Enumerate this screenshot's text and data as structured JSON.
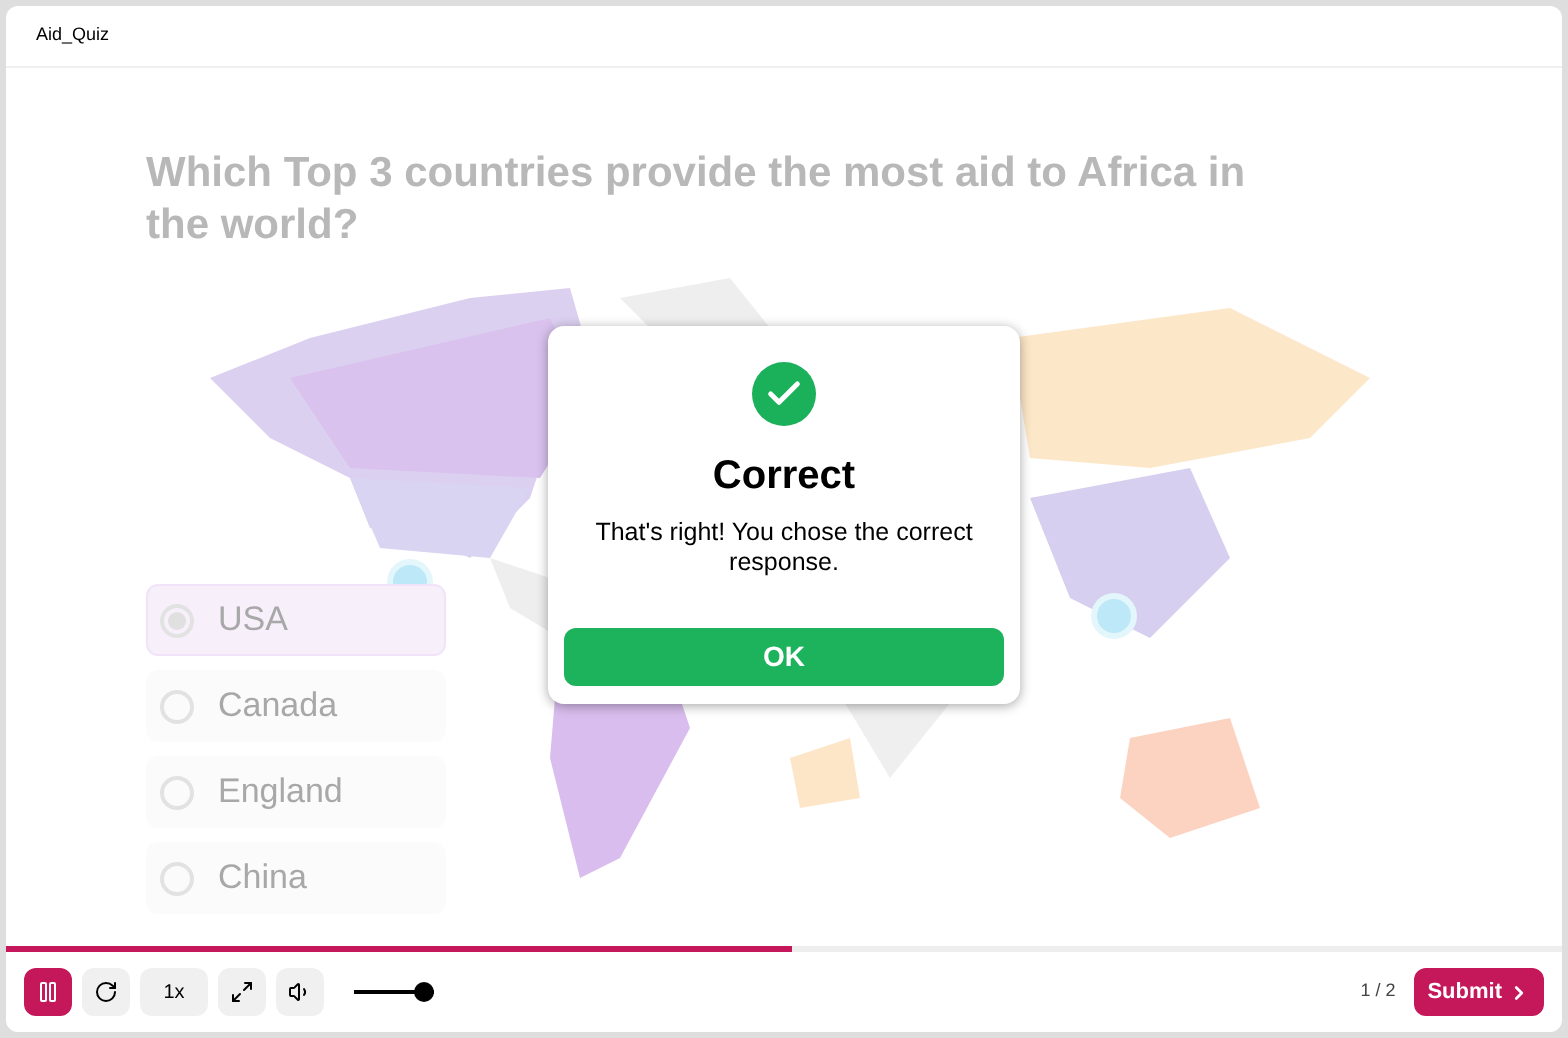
{
  "window": {
    "title": "Aid_Quiz"
  },
  "question": "Which Top 3 countries provide the most aid to Africa in the world?",
  "choices": [
    {
      "label": "USA",
      "selected": true
    },
    {
      "label": "Canada",
      "selected": false
    },
    {
      "label": "England",
      "selected": false
    },
    {
      "label": "China",
      "selected": false
    }
  ],
  "feedback": {
    "kind": "correct",
    "title": "Correct",
    "message": "That's right! You chose the correct response.",
    "button": "OK"
  },
  "player": {
    "progress": {
      "level": 0.505
    },
    "playing": true,
    "speed": "1x",
    "volume": {
      "level": 0.88
    },
    "page": "1 / 2",
    "submit": "Submit"
  }
}
